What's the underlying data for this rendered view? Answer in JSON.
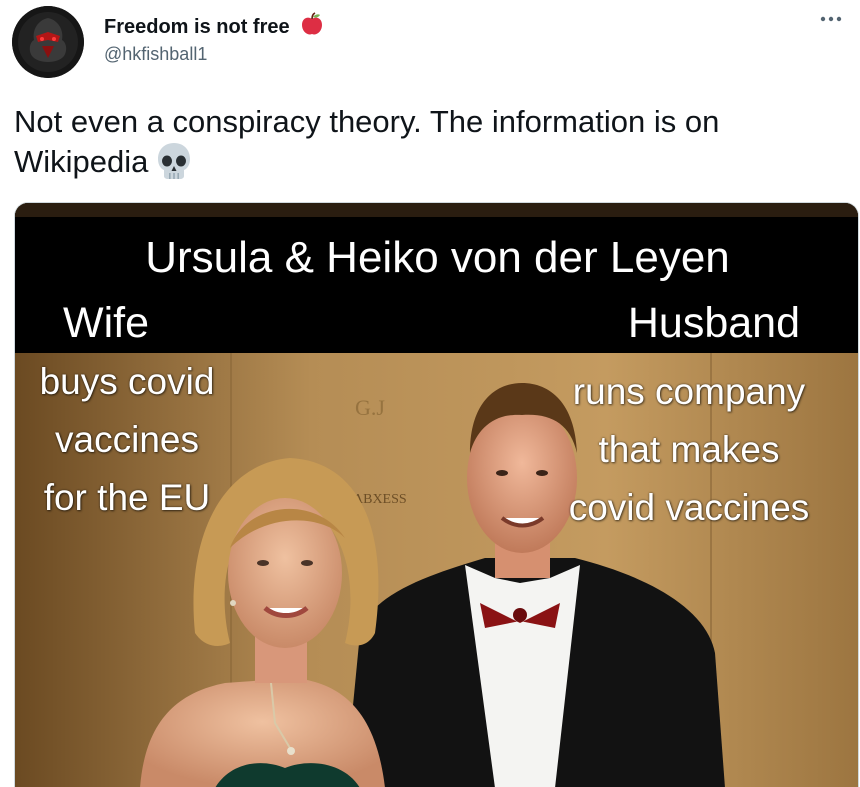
{
  "author": {
    "display_name": "Freedom is not free",
    "handle": "@hkfishball1",
    "name_emoji": "red-apple-icon"
  },
  "more_button_icon": "more-horizontal-icon",
  "tweet": {
    "text": "Not even a conspiracy theory. The information is on Wikipedia",
    "emoji": "skull-icon"
  },
  "media": {
    "meme": {
      "title": "Ursula & Heiko von der Leyen",
      "left_heading": "Wife",
      "right_heading": "Husband",
      "left_lines": [
        "buys covid",
        "vaccines",
        "for the EU"
      ],
      "right_lines": [
        "runs company",
        "that makes",
        "covid vaccines"
      ]
    },
    "backdrop_logo_text": "G.J",
    "backdrop_text": "ABXESS"
  },
  "colors": {
    "text_primary": "#0f1419",
    "text_secondary": "#536471",
    "meme_band": "#000000",
    "backdrop": "#b88e54"
  }
}
